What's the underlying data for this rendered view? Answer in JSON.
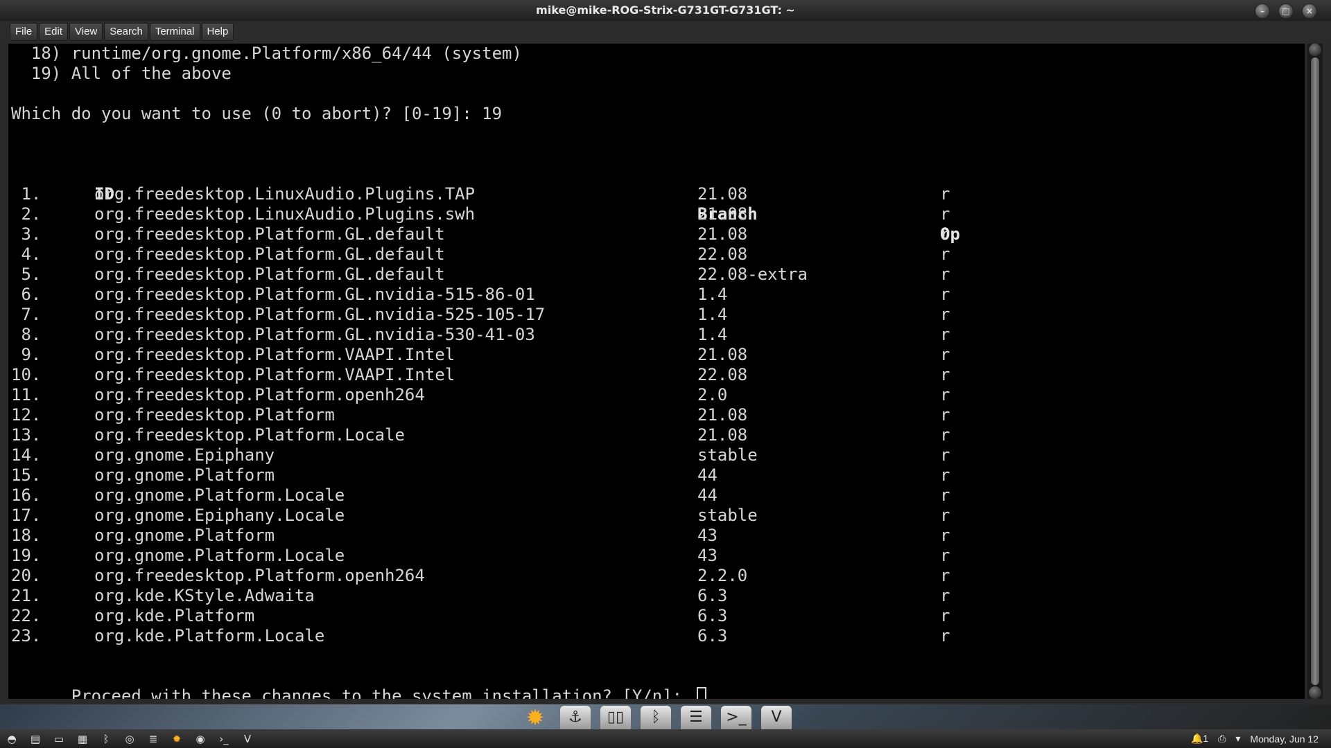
{
  "window": {
    "title": "mike@mike-ROG-Strix-G731GT-G731GT: ~",
    "buttons": [
      "minimize-icon",
      "maximize-icon",
      "close-icon"
    ]
  },
  "menubar": {
    "items": [
      "File",
      "Edit",
      "View",
      "Search",
      "Terminal",
      "Help"
    ]
  },
  "terminal": {
    "pre_lines": [
      "  18) runtime/org.gnome.Platform/x86_64/44 (system)",
      "  19) All of the above",
      "",
      "Which do you want to use (0 to abort)? [0-19]: 19"
    ],
    "table": {
      "headers": {
        "id": "ID",
        "branch": "Branch",
        "op": "Op"
      },
      "rows": [
        {
          "num": " 1.",
          "id": "org.freedesktop.LinuxAudio.Plugins.TAP",
          "branch": "21.08",
          "op": "r"
        },
        {
          "num": " 2.",
          "id": "org.freedesktop.LinuxAudio.Plugins.swh",
          "branch": "21.08",
          "op": "r"
        },
        {
          "num": " 3.",
          "id": "org.freedesktop.Platform.GL.default",
          "branch": "21.08",
          "op": "r"
        },
        {
          "num": " 4.",
          "id": "org.freedesktop.Platform.GL.default",
          "branch": "22.08",
          "op": "r"
        },
        {
          "num": " 5.",
          "id": "org.freedesktop.Platform.GL.default",
          "branch": "22.08-extra",
          "op": "r"
        },
        {
          "num": " 6.",
          "id": "org.freedesktop.Platform.GL.nvidia-515-86-01",
          "branch": "1.4",
          "op": "r"
        },
        {
          "num": " 7.",
          "id": "org.freedesktop.Platform.GL.nvidia-525-105-17",
          "branch": "1.4",
          "op": "r"
        },
        {
          "num": " 8.",
          "id": "org.freedesktop.Platform.GL.nvidia-530-41-03",
          "branch": "1.4",
          "op": "r"
        },
        {
          "num": " 9.",
          "id": "org.freedesktop.Platform.VAAPI.Intel",
          "branch": "21.08",
          "op": "r"
        },
        {
          "num": "10.",
          "id": "org.freedesktop.Platform.VAAPI.Intel",
          "branch": "22.08",
          "op": "r"
        },
        {
          "num": "11.",
          "id": "org.freedesktop.Platform.openh264",
          "branch": "2.0",
          "op": "r"
        },
        {
          "num": "12.",
          "id": "org.freedesktop.Platform",
          "branch": "21.08",
          "op": "r"
        },
        {
          "num": "13.",
          "id": "org.freedesktop.Platform.Locale",
          "branch": "21.08",
          "op": "r"
        },
        {
          "num": "14.",
          "id": "org.gnome.Epiphany",
          "branch": "stable",
          "op": "r"
        },
        {
          "num": "15.",
          "id": "org.gnome.Platform",
          "branch": "44",
          "op": "r"
        },
        {
          "num": "16.",
          "id": "org.gnome.Platform.Locale",
          "branch": "44",
          "op": "r"
        },
        {
          "num": "17.",
          "id": "org.gnome.Epiphany.Locale",
          "branch": "stable",
          "op": "r"
        },
        {
          "num": "18.",
          "id": "org.gnome.Platform",
          "branch": "43",
          "op": "r"
        },
        {
          "num": "19.",
          "id": "org.gnome.Platform.Locale",
          "branch": "43",
          "op": "r"
        },
        {
          "num": "20.",
          "id": "org.freedesktop.Platform.openh264",
          "branch": "2.2.0",
          "op": "r"
        },
        {
          "num": "21.",
          "id": "org.kde.KStyle.Adwaita",
          "branch": "6.3",
          "op": "r"
        },
        {
          "num": "22.",
          "id": "org.kde.Platform",
          "branch": "6.3",
          "op": "r"
        },
        {
          "num": "23.",
          "id": "org.kde.Platform.Locale",
          "branch": "6.3",
          "op": "r"
        }
      ]
    },
    "prompt": "Proceed with these changes to the system installation? [Y/n]: "
  },
  "dock": {
    "icons": [
      "sun-icon",
      "anchor-icon",
      "controller-icon",
      "bluetooth-icon",
      "menu-icon",
      "terminal-icon",
      "vivaldi-icon"
    ]
  },
  "taskbar": {
    "left_icons": [
      "start-icon",
      "files-icon",
      "window-icon",
      "exif-icon",
      "bluetooth-icon",
      "safari-icon",
      "notes-icon",
      "sun-icon",
      "camera-icon",
      "terminal-icon",
      "vivaldi-icon"
    ],
    "notification_count": "1",
    "clock": "Monday, Jun 12"
  },
  "colors": {
    "terminal_bg": "#000000",
    "terminal_fg": "#d6d6d6",
    "sun_icon": "#ffb020"
  }
}
